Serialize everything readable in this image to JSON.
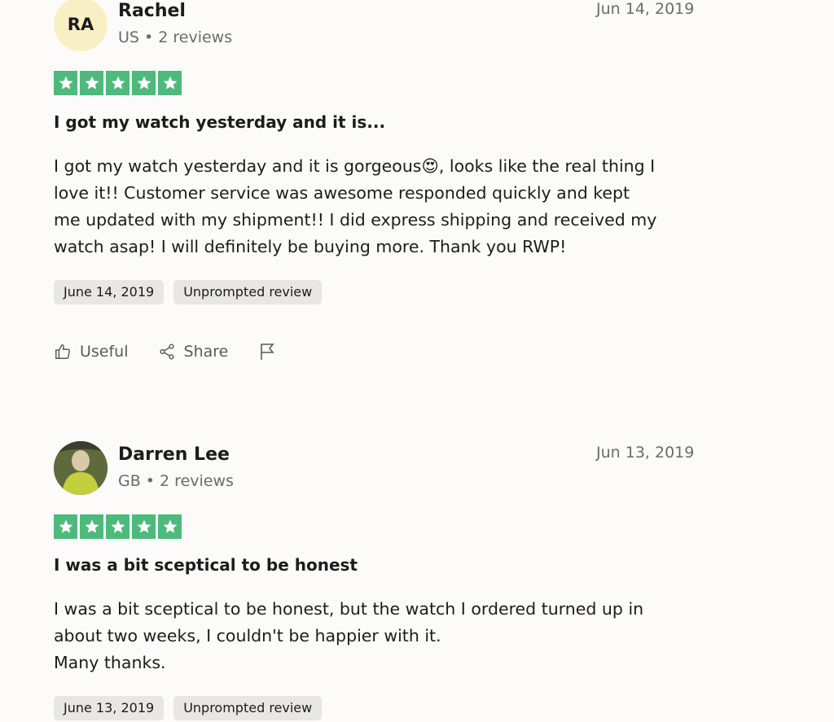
{
  "reviews": [
    {
      "avatar_initials": "RA",
      "name": "Rachel",
      "meta": "US • 2 reviews",
      "date": "Jun 14, 2019",
      "rating": 5,
      "title": "I got my watch yesterday and it is...",
      "body_lines": [
        "I got my watch yesterday and it is gorgeous😍, looks like the real thing I",
        "love it!! Customer service was awesome responded quickly and kept",
        "me updated with my shipment!! I did express shipping and received my",
        "watch asap! I will definitely be buying more. Thank you RWP!"
      ],
      "experience_date": "June 14, 2019",
      "tag": "Unprompted review",
      "actions": {
        "useful": "Useful",
        "share": "Share"
      }
    },
    {
      "name": "Darren Lee",
      "meta": "GB • 2 reviews",
      "date": "Jun 13, 2019",
      "rating": 5,
      "title": "I was a bit sceptical to be honest",
      "body_lines": [
        "I was a bit sceptical to be honest, but the watch I ordered turned up in",
        "about two weeks, I couldn't be happier with it.",
        "Many thanks."
      ],
      "experience_date": "June 13, 2019",
      "tag": "Unprompted review"
    }
  ],
  "colors": {
    "star_green": "#4dba7b",
    "avatar_bg": "#f8f0c4",
    "tag_bg": "#e8e7e4"
  },
  "icons": [
    "star-icon",
    "thumbs-up-icon",
    "share-icon",
    "flag-icon"
  ]
}
